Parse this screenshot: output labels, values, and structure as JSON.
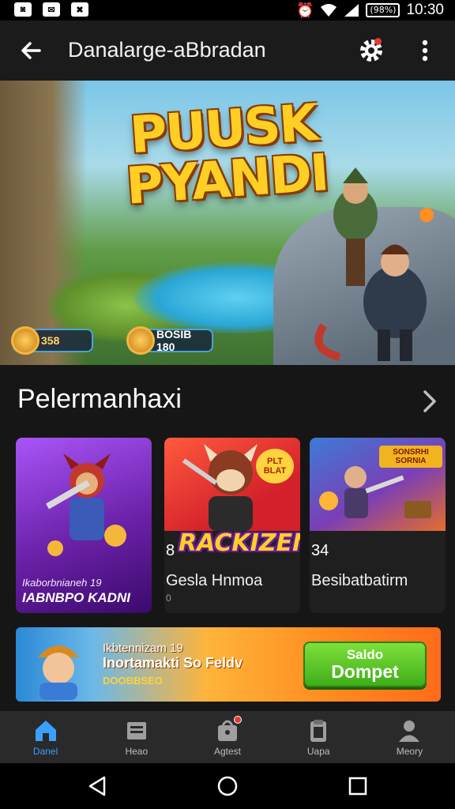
{
  "status_bar": {
    "notifications": [
      "◙",
      "✉",
      "✖"
    ],
    "battery": "(98%)",
    "time": "10:30"
  },
  "app_bar": {
    "title": "Danalarge-aBbradan"
  },
  "hero": {
    "title_line1": "PUUSK",
    "title_line2": "PYANDI",
    "chip1_value": "358",
    "chip2_value": "BOSIB 180"
  },
  "section": {
    "title": "Pelermanhaxi"
  },
  "cards": [
    {
      "subtitle": "Ikaborbnianeh 19",
      "name": "IABNBPO KADNI"
    },
    {
      "rating": "8",
      "logo": "RACKIZEN",
      "badge": "PLT BLAT",
      "name": "Gesla Hnmoa",
      "meta": "0"
    },
    {
      "rating": "34",
      "banner": "SONSRHI SORNIA",
      "name": "Besibatbatirm"
    }
  ],
  "promo": {
    "line1": "Ikbtennizam 19",
    "line2": "Inortamakti So Feldv",
    "line3": "DOOBBSEO",
    "button_line1": "Saldo",
    "button_line2": "Dompet"
  },
  "bottom_nav": [
    {
      "label": "Danel",
      "icon": "home-icon",
      "active": true
    },
    {
      "label": "Heao",
      "icon": "inbox-icon",
      "active": false
    },
    {
      "label": "Agtest",
      "icon": "bag-icon",
      "active": false
    },
    {
      "label": "Uapa",
      "icon": "clipboard-icon",
      "active": false
    },
    {
      "label": "Meory",
      "icon": "person-icon",
      "active": false
    }
  ],
  "colors": {
    "accent": "#3aa0ff",
    "title_gold": "#ffcf26",
    "notification": "#e53935",
    "promo_button": "#5cc82a"
  }
}
